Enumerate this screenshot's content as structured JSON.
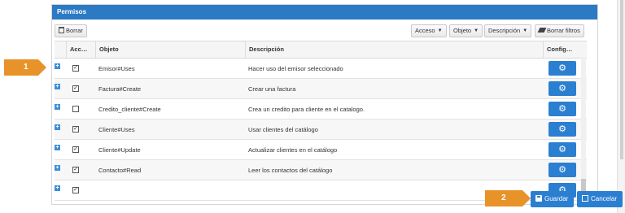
{
  "panel": {
    "title": "Permisos"
  },
  "toolbar": {
    "borrar_label": "Borrar",
    "filters": [
      {
        "label": "Acceso"
      },
      {
        "label": "Objeto"
      },
      {
        "label": "Descripción"
      }
    ],
    "clear_filters_label": "Borrar filtros"
  },
  "grid": {
    "columns": [
      "Acc…",
      "Objeto",
      "Descripción",
      "Config…"
    ],
    "rows": [
      {
        "checked": true,
        "objeto": "Emisor#Uses",
        "descripcion": "Hacer uso del emisor seleccionado"
      },
      {
        "checked": true,
        "objeto": "Factura#Create",
        "descripcion": "Crear una factura"
      },
      {
        "checked": false,
        "objeto": "Credito_cliente#Create",
        "descripcion": "Crea un credito para cliente en el catalogo."
      },
      {
        "checked": true,
        "objeto": "Cliente#Uses",
        "descripcion": "Usar clientes del catálogo"
      },
      {
        "checked": true,
        "objeto": "Cliente#Update",
        "descripcion": "Actualizar clientes en el catálogo"
      },
      {
        "checked": true,
        "objeto": "Contacto#Read",
        "descripcion": "Leer los contactos del catálogo"
      }
    ]
  },
  "callouts": {
    "first": "1",
    "second": "2"
  },
  "footer": {
    "save_label": "Guardar",
    "cancel_label": "Cancelar"
  },
  "colors": {
    "primary": "#2b7fd1",
    "heading": "#2c7ac4",
    "callout": "#e8922a"
  },
  "icons": {
    "expand": "plus-square-icon",
    "config": "gear-icon",
    "save": "floppy-icon",
    "cancel": "cancel-icon"
  }
}
